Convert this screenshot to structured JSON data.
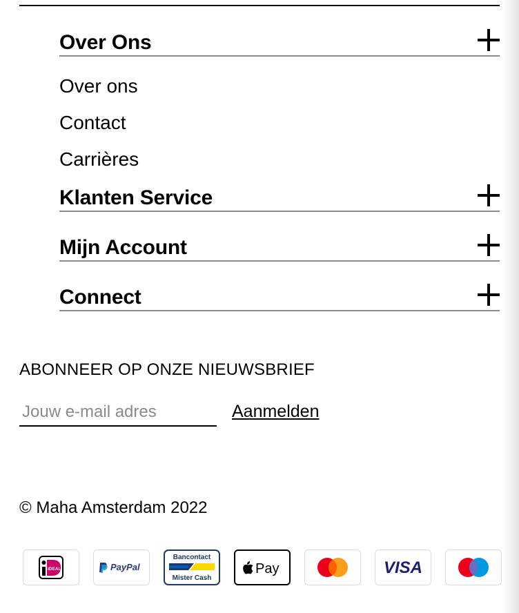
{
  "accordion": {
    "sections": [
      {
        "title": "Over Ons",
        "links": [
          "Over ons",
          "Contact",
          "Carrières"
        ]
      },
      {
        "title": "Klanten Service"
      },
      {
        "title": "Mijn Account"
      },
      {
        "title": "Connect"
      }
    ]
  },
  "newsletter": {
    "title": "ABONNEER OP ONZE NIEUWSBRIEF",
    "email_placeholder": "Jouw e-mail adres",
    "submit_label": "Aanmelden"
  },
  "footer": {
    "copyright": "© Maha Amsterdam 2022"
  },
  "payment_methods": {
    "ideal": {
      "icon": "ideal-icon",
      "text": "iDEAL"
    },
    "paypal": {
      "icon": "paypal-icon",
      "text": "PayPal"
    },
    "bancontact": {
      "icon": "bancontact-icon",
      "line1": "Bancontact",
      "line2": "Mister Cash"
    },
    "applepay": {
      "icon": "apple-pay-icon",
      "text": "Pay"
    },
    "mastercard": {
      "icon": "mastercard-icon"
    },
    "visa": {
      "icon": "visa-icon",
      "text": "VISA"
    },
    "maestro": {
      "icon": "maestro-icon"
    }
  },
  "colors": {
    "text": "#000000",
    "divider": "#8a8a8a",
    "placeholder": "#8a8a8a",
    "paypal_blue": "#253b80",
    "paypal_light": "#179bd7",
    "mastercard_red": "#eb001b",
    "mastercard_orange": "#f79e1b",
    "visa_blue": "#1a1f71",
    "maestro_blue": "#0099df"
  }
}
